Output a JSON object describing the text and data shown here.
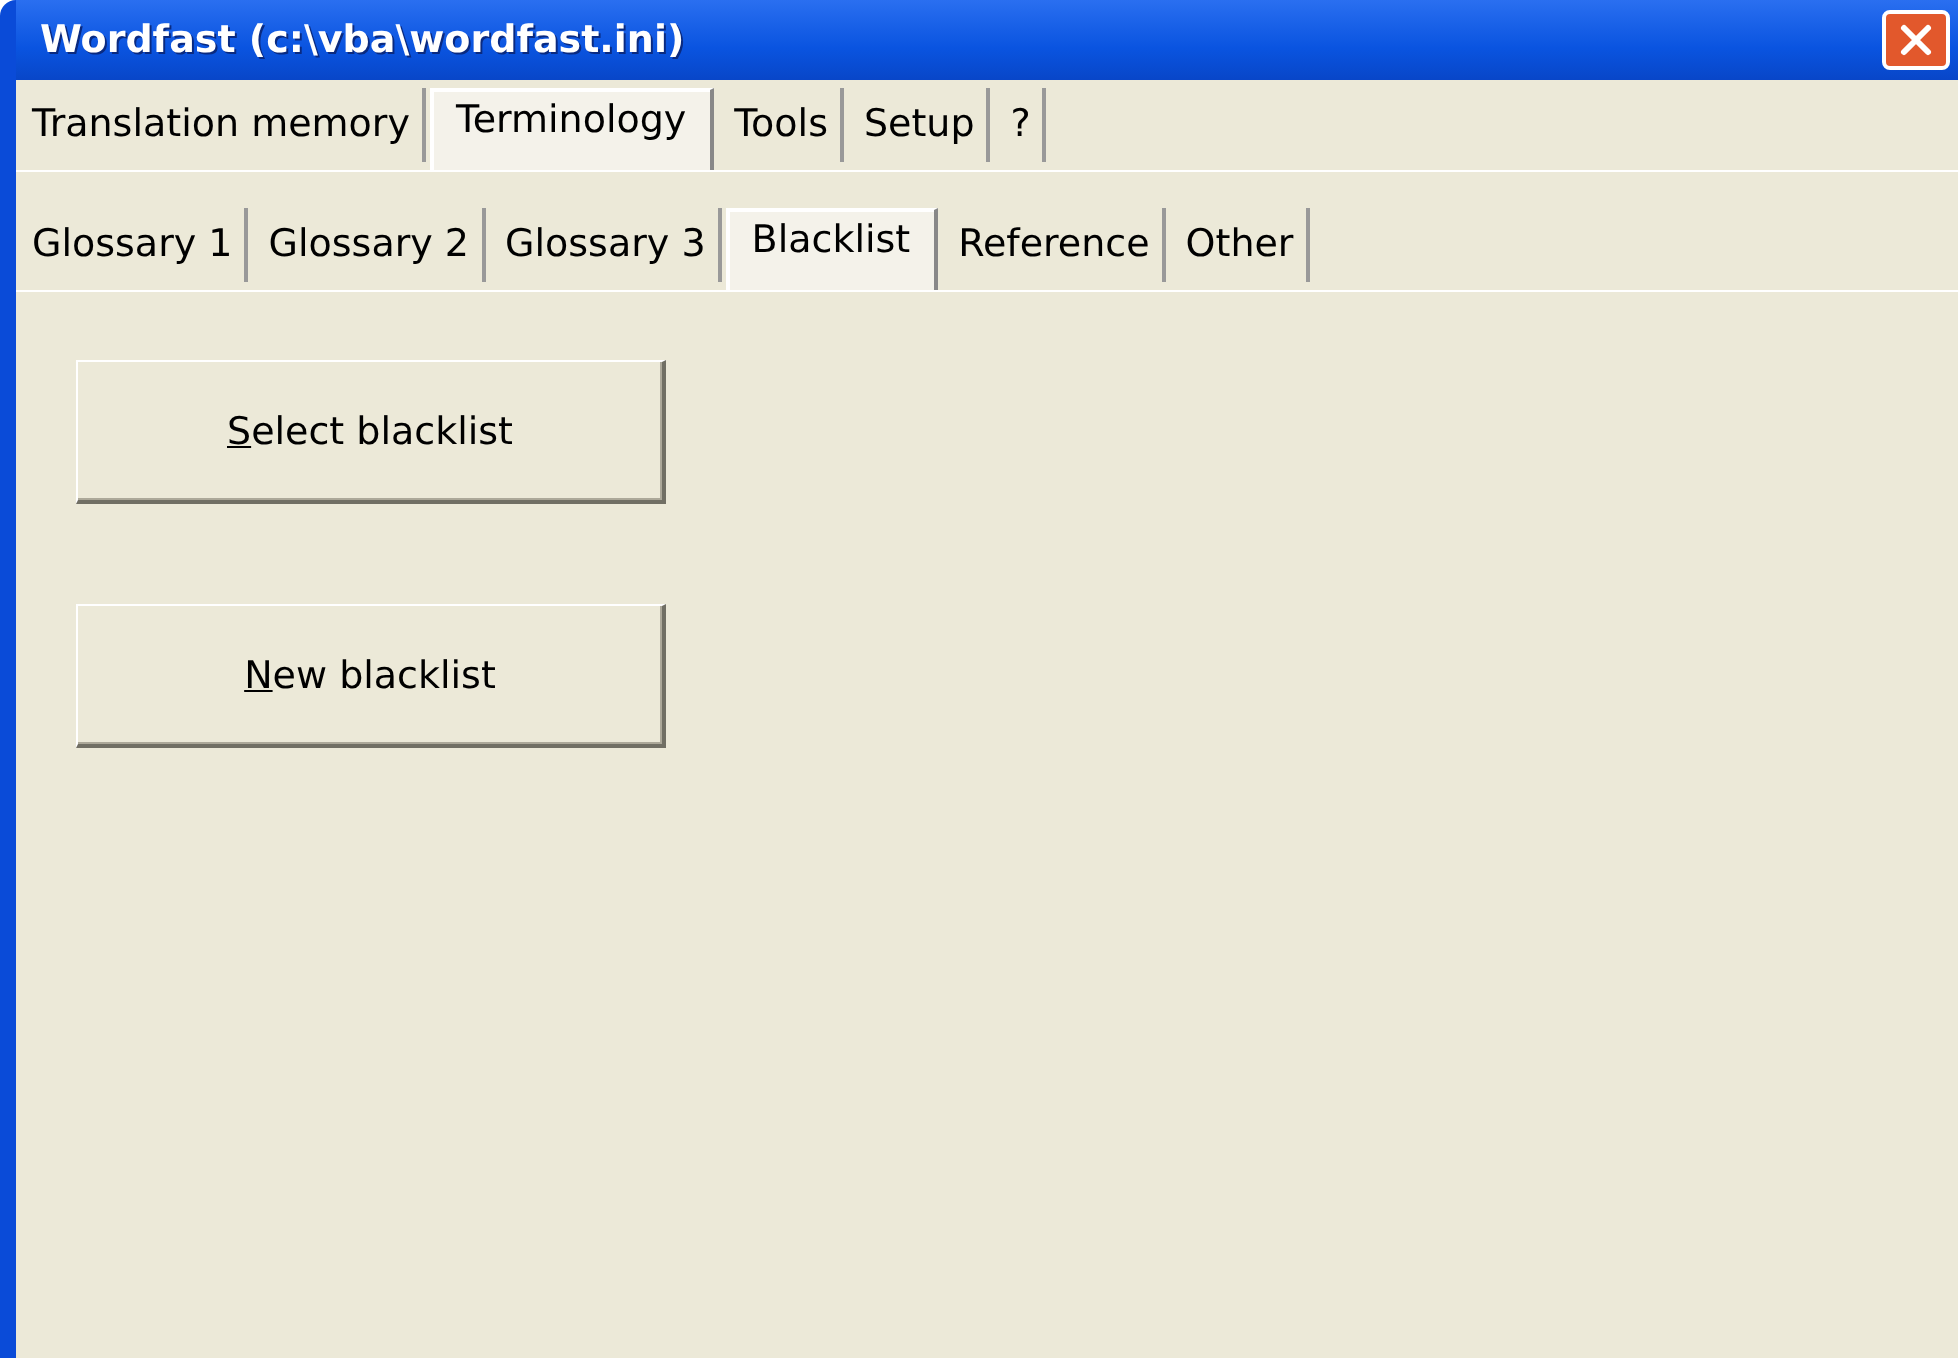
{
  "window": {
    "title": "Wordfast (c:\\vba\\wordfast.ini)"
  },
  "tabs": [
    {
      "label": "Translation memory",
      "selected": false
    },
    {
      "label": "Terminology",
      "selected": true
    },
    {
      "label": "Tools",
      "selected": false
    },
    {
      "label": "Setup",
      "selected": false
    },
    {
      "label": "?",
      "selected": false
    }
  ],
  "subtabs": [
    {
      "label": "Glossary 1",
      "selected": false
    },
    {
      "label": "Glossary 2",
      "selected": false
    },
    {
      "label": "Glossary 3",
      "selected": false
    },
    {
      "label": "Blacklist",
      "selected": true
    },
    {
      "label": "Reference",
      "selected": false
    },
    {
      "label": "Other",
      "selected": false
    }
  ],
  "buttons": [
    {
      "access_key": "S",
      "label_rest": "elect blacklist"
    },
    {
      "access_key": "N",
      "label_rest": "ew blacklist"
    }
  ]
}
